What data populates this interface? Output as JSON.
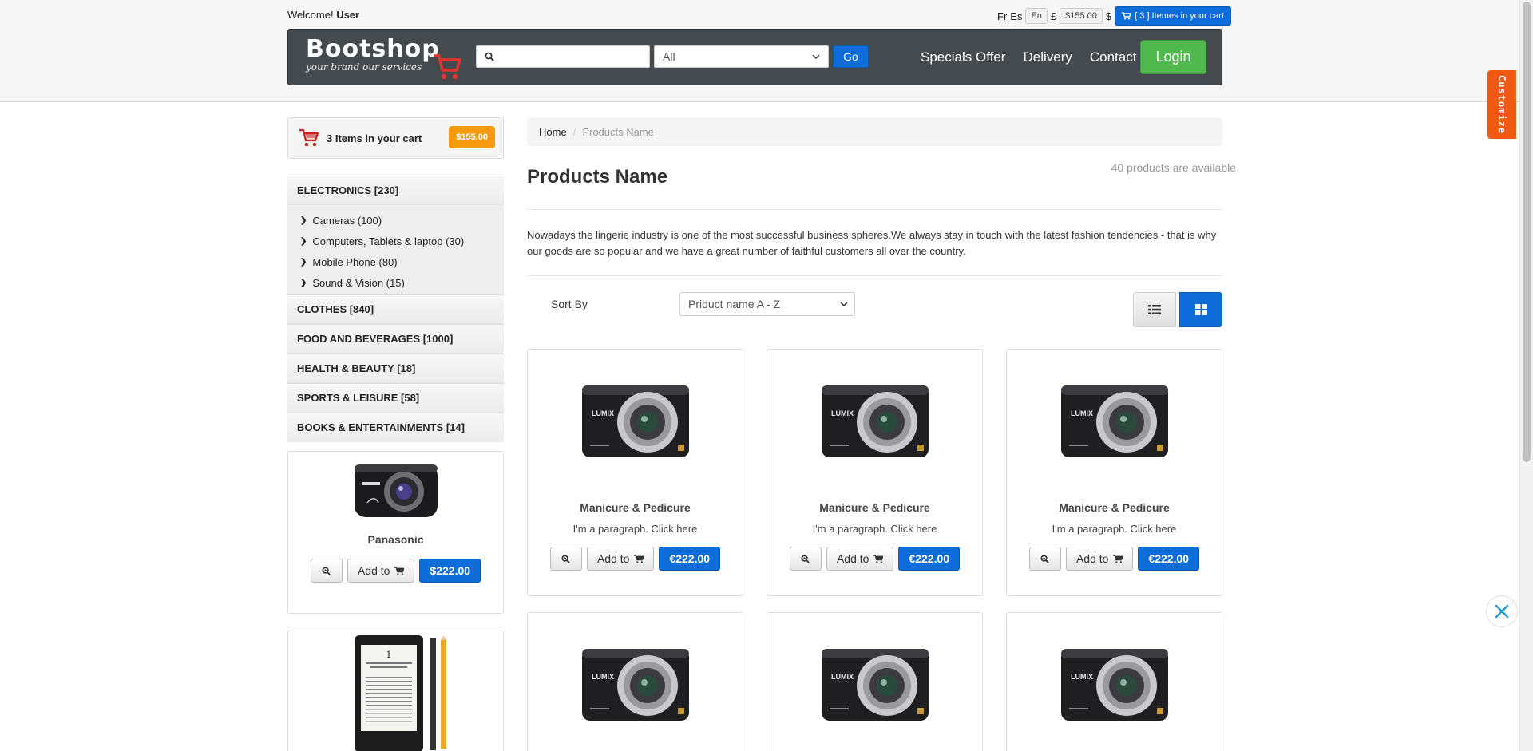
{
  "header": {
    "welcome_prefix": "Welcome!",
    "welcome_user": "User",
    "lang_fr": "Fr",
    "lang_es": "Es",
    "lang_en": "En",
    "currency_gbp": "£",
    "cart_total": "$155.00",
    "currency_usd": "$",
    "cart_button": "[ 3 ] Itemes in your cart"
  },
  "nav": {
    "logo_text": "Bootshop",
    "logo_tagline": "your brand our services",
    "search_placeholder": "",
    "category_select": "All",
    "go_label": "Go",
    "links": [
      "Specials Offer",
      "Delivery",
      "Contact"
    ],
    "login_label": "Login"
  },
  "customize_label": "Customize",
  "sidebar": {
    "cart_text": "3 Items in your cart",
    "cart_price": "$155.00",
    "categories": [
      {
        "label": "ELECTRONICS [230]",
        "subcategories": [
          "Cameras (100)",
          "Computers, Tablets & laptop (30)",
          "Mobile Phone (80)",
          "Sound & Vision (15)"
        ]
      },
      {
        "label": "CLOTHES [840]"
      },
      {
        "label": "FOOD AND BEVERAGES [1000]"
      },
      {
        "label": "HEALTH & BEAUTY [18]"
      },
      {
        "label": "SPORTS & LEISURE [58]"
      },
      {
        "label": "BOOKS & ENTERTAINMENTS [14]"
      }
    ],
    "featured": {
      "name": "Panasonic",
      "add_label": "Add to",
      "price": "$222.00"
    }
  },
  "main": {
    "breadcrumb_home": "Home",
    "breadcrumb_current": "Products Name",
    "title": "Products Name",
    "available": "40 products are available",
    "description": "Nowadays the lingerie industry is one of the most successful business spheres.We always stay in touch with the latest fashion tendencies - that is why our goods are so popular and we have a great number of faithful customers all over the country.",
    "sort_label": "Sort By",
    "sort_value": "Priduct name A - Z",
    "products": [
      {
        "name": "Manicure & Pedicure",
        "para": "I'm a paragraph. Click here",
        "add_label": "Add to",
        "price": "€222.00"
      },
      {
        "name": "Manicure & Pedicure",
        "para": "I'm a paragraph. Click here",
        "add_label": "Add to",
        "price": "€222.00"
      },
      {
        "name": "Manicure & Pedicure",
        "para": "I'm a paragraph. Click here",
        "add_label": "Add to",
        "price": "€222.00"
      },
      {
        "name": "",
        "para": "",
        "add_label": "",
        "price": ""
      },
      {
        "name": "",
        "para": "",
        "add_label": "",
        "price": ""
      },
      {
        "name": "",
        "para": "",
        "add_label": "",
        "price": ""
      }
    ]
  },
  "colors": {
    "accent_blue": "#0e6dd8",
    "login_green": "#51b84e",
    "cart_orange": "#f59a0c",
    "customize_orange": "#f25a14",
    "navbar": "#454a4f"
  }
}
